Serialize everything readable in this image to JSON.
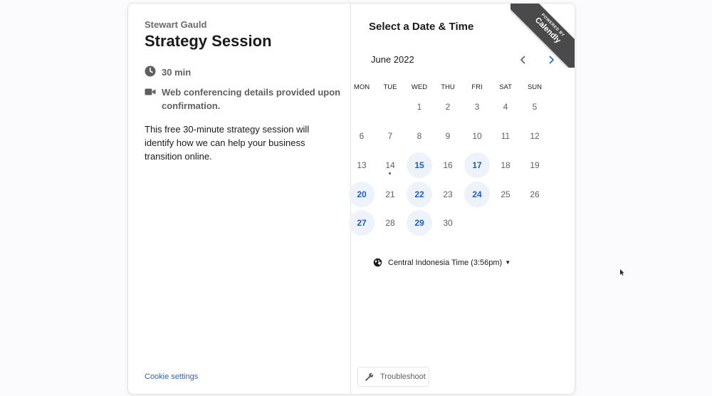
{
  "event": {
    "owner": "Stewart Gauld",
    "title": "Strategy Session",
    "duration": "30 min",
    "conferencing_line1": "Web conferencing details provided upon",
    "conferencing_line2": "confirmation.",
    "description": "This free 30-minute strategy session will identify how we can help your business transition online.",
    "cookie_settings": "Cookie settings"
  },
  "calendar": {
    "heading": "Select a Date & Time",
    "month_label": "June 2022",
    "weekdays": [
      "MON",
      "TUE",
      "WED",
      "THU",
      "FRI",
      "SAT",
      "SUN"
    ],
    "first_weekday_index": 2,
    "days_in_month": 30,
    "today": 14,
    "available_days": [
      15,
      17,
      20,
      22,
      24,
      27,
      29
    ],
    "prev_icon": "chevron-left-icon",
    "next_icon": "chevron-right-icon"
  },
  "timezone": {
    "label": "Central Indonesia Time (3:56pm)",
    "icon": "globe-icon"
  },
  "branding": {
    "powered_by": "POWERED BY",
    "brand": "Calendly"
  },
  "troubleshoot": {
    "label": "Troubleshoot",
    "icon": "wrench-icon"
  },
  "colors": {
    "accent": "#1a5fcc",
    "available_bg": "#eef2fb",
    "link": "#2a66c4",
    "ribbon": "#4a4a4a"
  }
}
